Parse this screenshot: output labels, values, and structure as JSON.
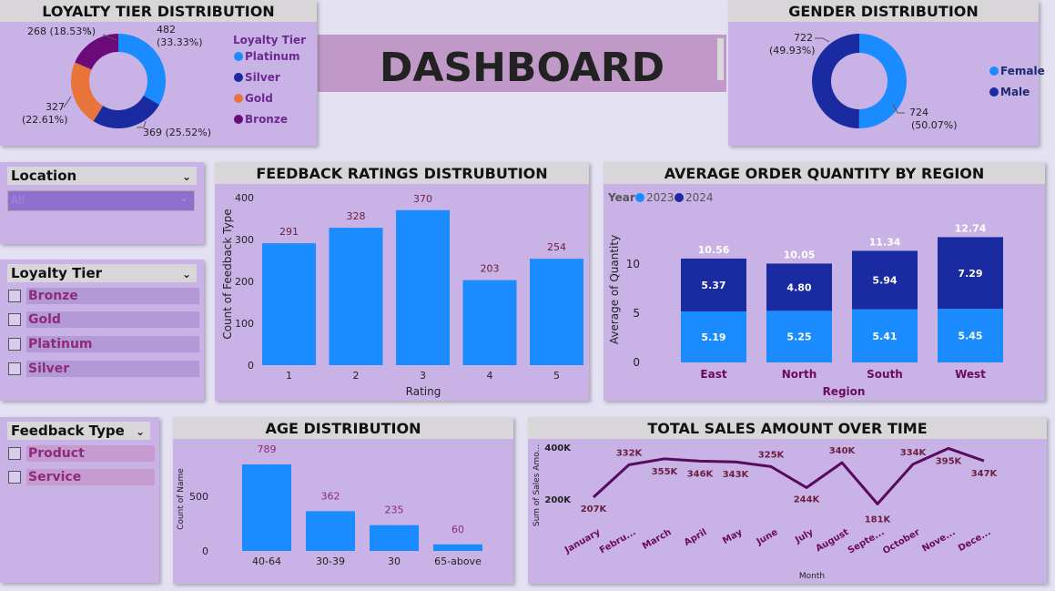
{
  "header": {
    "title": "DASHBOARD"
  },
  "loyalty_panel": {
    "title": "LOYALTY TIER DISTRIBUTION",
    "legend_title": "Loyalty Tier",
    "slices": [
      {
        "name": "Platinum",
        "value": 482,
        "pct": "(33.33%)",
        "color": "#1a8cff"
      },
      {
        "name": "Silver",
        "value": 369,
        "pct": "(25.52%)",
        "color": "#1a2aa0"
      },
      {
        "name": "Gold",
        "value": 327,
        "pct": "(22.61%)",
        "color": "#e8743b"
      },
      {
        "name": "Bronze",
        "value": 268,
        "pct": "(18.53%)",
        "color": "#6b0b7a"
      }
    ],
    "labels": {
      "platinum_a": "482",
      "platinum_b": "(33.33%)",
      "silver": "369 (25.52%)",
      "gold_a": "327",
      "gold_b": "(22.61%)",
      "bronze": "268 (18.53%)"
    }
  },
  "gender_panel": {
    "title": "GENDER DISTRIBUTION",
    "slices": [
      {
        "name": "Female",
        "value": 724,
        "pct": "(50.07%)",
        "color": "#1a8cff"
      },
      {
        "name": "Male",
        "value": 722,
        "pct": "(49.93%)",
        "color": "#1a2aa0"
      }
    ],
    "labels": {
      "male_a": "722",
      "male_b": "(49.93%)",
      "female_a": "724",
      "female_b": "(50.07%)"
    }
  },
  "location_slicer": {
    "title": "Location",
    "selected": "All"
  },
  "loyalty_slicer": {
    "title": "Loyalty Tier",
    "options": [
      "Bronze",
      "Gold",
      "Platinum",
      "Silver"
    ]
  },
  "feedback_slicer": {
    "title": "Feedback Type",
    "options": [
      "Product",
      "Service"
    ]
  },
  "colors": {
    "accent": "#1a8cff",
    "dark": "#1a2aa0",
    "line": "#5a0a5e",
    "panel": "#c9b2e6"
  },
  "chart_data": [
    {
      "type": "bar",
      "title": "FEEDBACK RATINGS DISTRUBUTION",
      "xlabel": "Rating",
      "ylabel": "Count of Feedback Type",
      "categories": [
        "1",
        "2",
        "3",
        "4",
        "5"
      ],
      "values": [
        291,
        328,
        370,
        203,
        254
      ],
      "ylim": [
        0,
        400
      ],
      "yticks": [
        "0",
        "100",
        "200",
        "300",
        "400"
      ]
    },
    {
      "type": "bar",
      "title": "AVERAGE ORDER QUANTITY BY REGION",
      "xlabel": "Region",
      "ylabel": "Average of Quantity",
      "legend_title": "Year",
      "categories": [
        "East",
        "North",
        "South",
        "West"
      ],
      "series": [
        {
          "name": "2023",
          "values": [
            5.19,
            5.25,
            5.41,
            5.45
          ]
        },
        {
          "name": "2024",
          "values": [
            5.37,
            4.8,
            5.94,
            7.29
          ]
        }
      ],
      "totals": [
        "10.56",
        "10.05",
        "11.34",
        "12.74"
      ],
      "yticks": [
        "0",
        "5",
        "10"
      ]
    },
    {
      "type": "bar",
      "title": "AGE DISTRIBUTION",
      "ylabel": "Count of Name",
      "categories": [
        "40-64",
        "30-39",
        "30",
        "65-above"
      ],
      "values": [
        789,
        362,
        235,
        60
      ],
      "yticks": [
        "0",
        "500"
      ]
    },
    {
      "type": "line",
      "title": "TOTAL SALES AMOUNT OVER TIME",
      "xlabel": "Month",
      "ylabel": "Sum of Sales Amo...",
      "categories": [
        "January",
        "Febru...",
        "March",
        "April",
        "May",
        "June",
        "July",
        "August",
        "Septe...",
        "October",
        "Nove...",
        "Dece..."
      ],
      "values": [
        207,
        332,
        355,
        346,
        343,
        325,
        244,
        340,
        181,
        334,
        395,
        347
      ],
      "labels": [
        "207K",
        "332K",
        "355K",
        "346K",
        "343K",
        "325K",
        "244K",
        "340K",
        "181K",
        "334K",
        "395K",
        "347K"
      ],
      "yticks": [
        "200K",
        "400K"
      ]
    }
  ]
}
